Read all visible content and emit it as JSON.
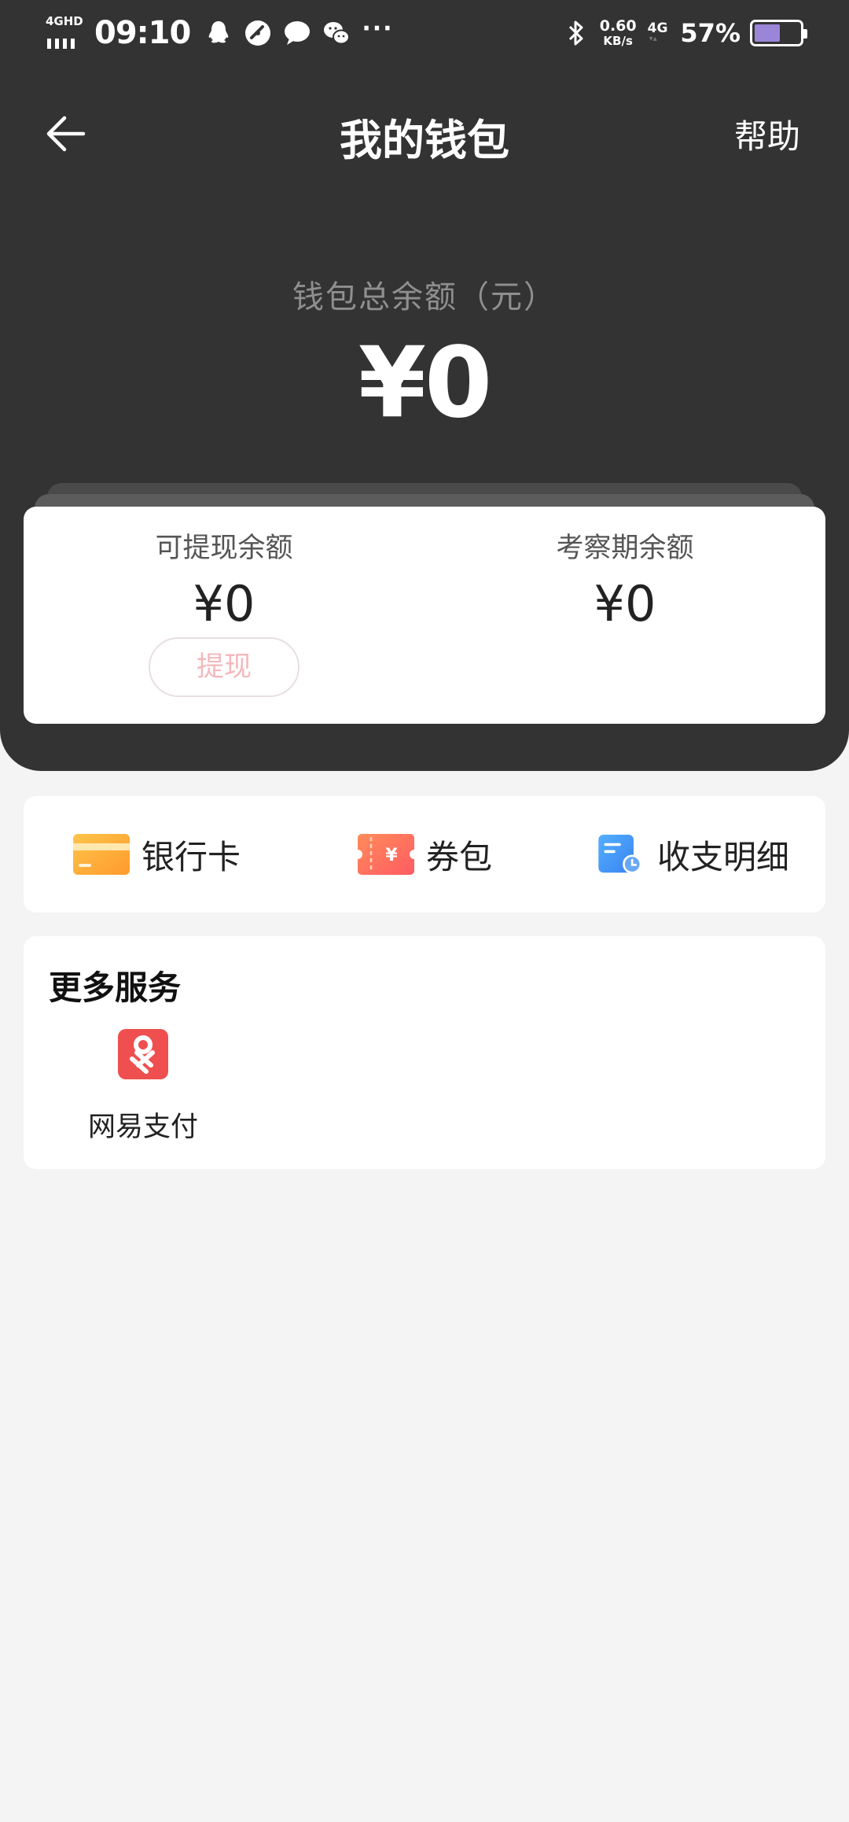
{
  "status_bar": {
    "network": "4GHD",
    "time": "09:10",
    "speed_value": "0.60",
    "speed_unit": "KB/s",
    "lte": "4G",
    "battery_percent": "57%",
    "battery_level": 0.57,
    "icons": [
      "qq-icon",
      "speedometer-icon",
      "message-icon",
      "wechat-icon",
      "more-dots-icon",
      "bluetooth-icon"
    ]
  },
  "nav": {
    "title": "我的钱包",
    "help": "帮助"
  },
  "wallet": {
    "total_label": "钱包总余额（元）",
    "total_amount": "¥0"
  },
  "balances": {
    "withdrawable_label": "可提现余额",
    "withdrawable_amount": "¥0",
    "withdraw_button": "提现",
    "review_label": "考察期余额",
    "review_amount": "¥0"
  },
  "shortcuts": [
    {
      "label": "银行卡",
      "icon": "bank-card-icon"
    },
    {
      "label": "券包",
      "icon": "coupon-icon"
    },
    {
      "label": "收支明细",
      "icon": "statement-icon"
    }
  ],
  "services": {
    "title": "更多服务",
    "items": [
      {
        "label": "网易支付",
        "icon": "netease-pay-icon"
      }
    ]
  },
  "colors": {
    "header_bg": "#333333",
    "page_bg": "#f4f4f4",
    "withdraw_text": "#f4b8bc",
    "bank_card": "#ffb23f",
    "coupon": "#ff6a5c",
    "statement": "#4a9bf5",
    "netease_pay": "#ef4f4f"
  }
}
